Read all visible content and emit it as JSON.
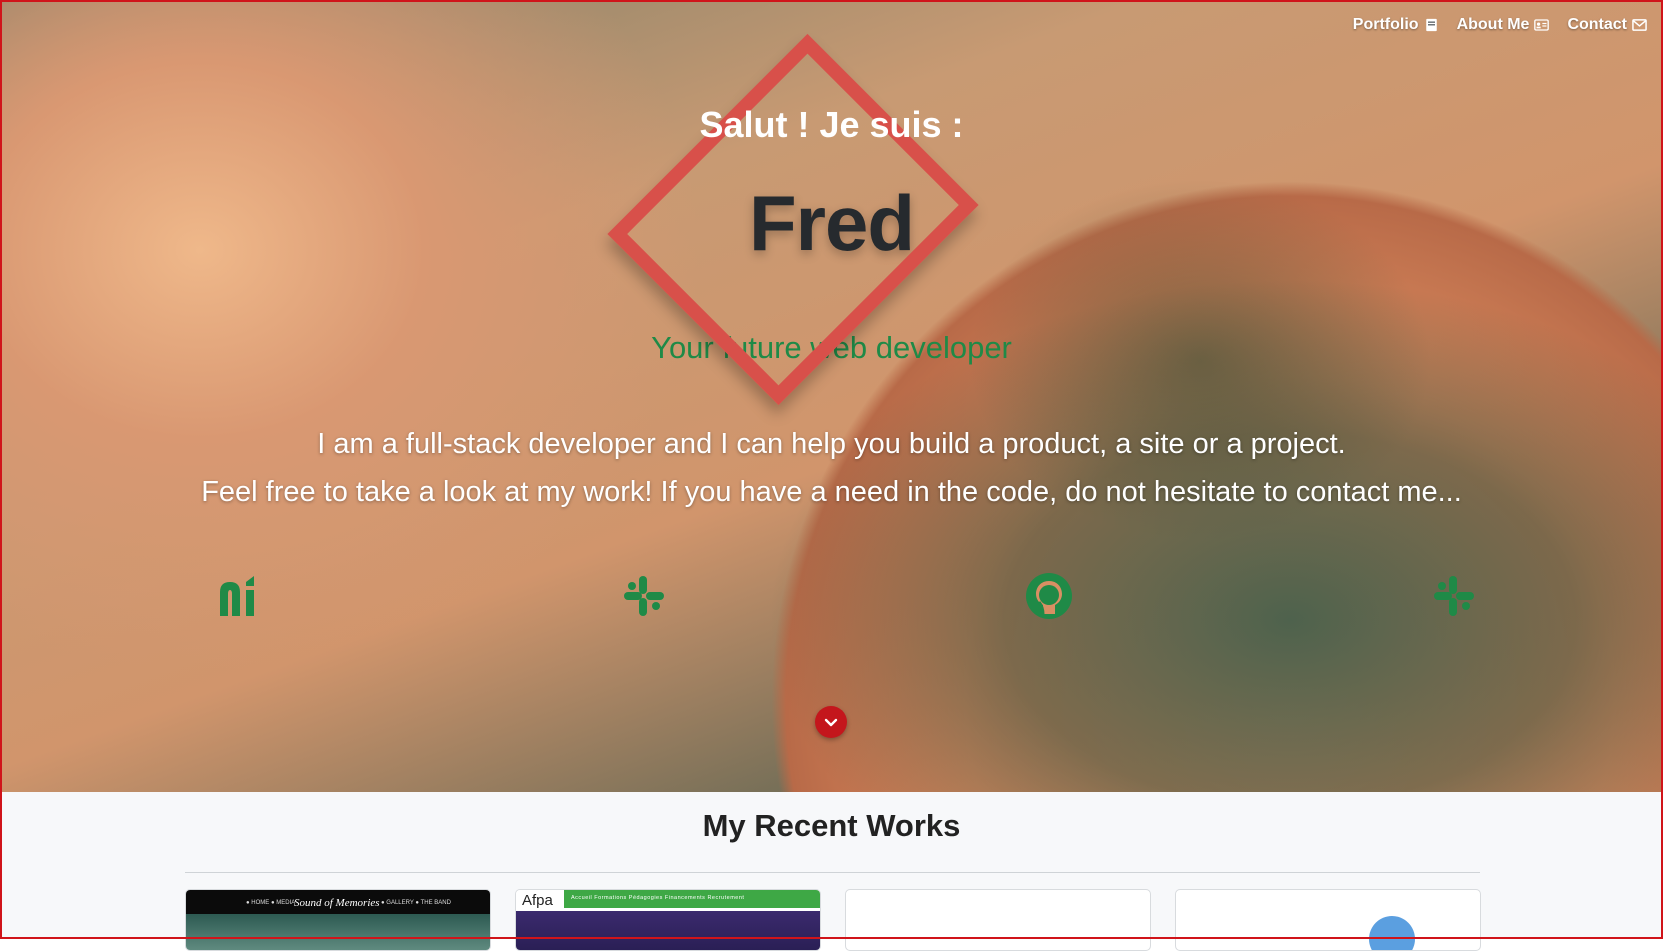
{
  "nav": {
    "items": [
      {
        "label": "Portfolio",
        "icon": "book-icon"
      },
      {
        "label": "About Me",
        "icon": "id-card-icon"
      },
      {
        "label": "Contact",
        "icon": "envelope-icon"
      }
    ]
  },
  "hero": {
    "greeting": "Salut ! Je suis :",
    "name": "Fred",
    "tagline": "Your future web developer",
    "intro_line1": "I am a full-stack developer and I can help you build a product, a site or a project.",
    "intro_line2": "Feel free to take a look at my work! If you have a need in the code, do not hesitate to contact me..."
  },
  "social": [
    {
      "name": "ni-logo-icon"
    },
    {
      "name": "slack-icon"
    },
    {
      "name": "github-icon"
    },
    {
      "name": "slack-icon"
    }
  ],
  "scroll_icon": "chevron-down-icon",
  "works": {
    "title": "My Recent Works",
    "cards": [
      {
        "thumb_nav": "● HOME   ● MEDIA",
        "thumb_title": "Sound of Memories",
        "thumb_nav_right": "● GALLERY   ● THE BAND"
      },
      {
        "thumb_brand": "Afpa",
        "thumb_menu": "Accueil    Formations    Pédagogies    Financements    Recrutement"
      },
      {},
      {}
    ]
  },
  "colors": {
    "accent_green": "#1f8a47",
    "name_dark": "#262a2e",
    "scroll_red": "#c4161c",
    "diamond_red": "#d8504a"
  }
}
